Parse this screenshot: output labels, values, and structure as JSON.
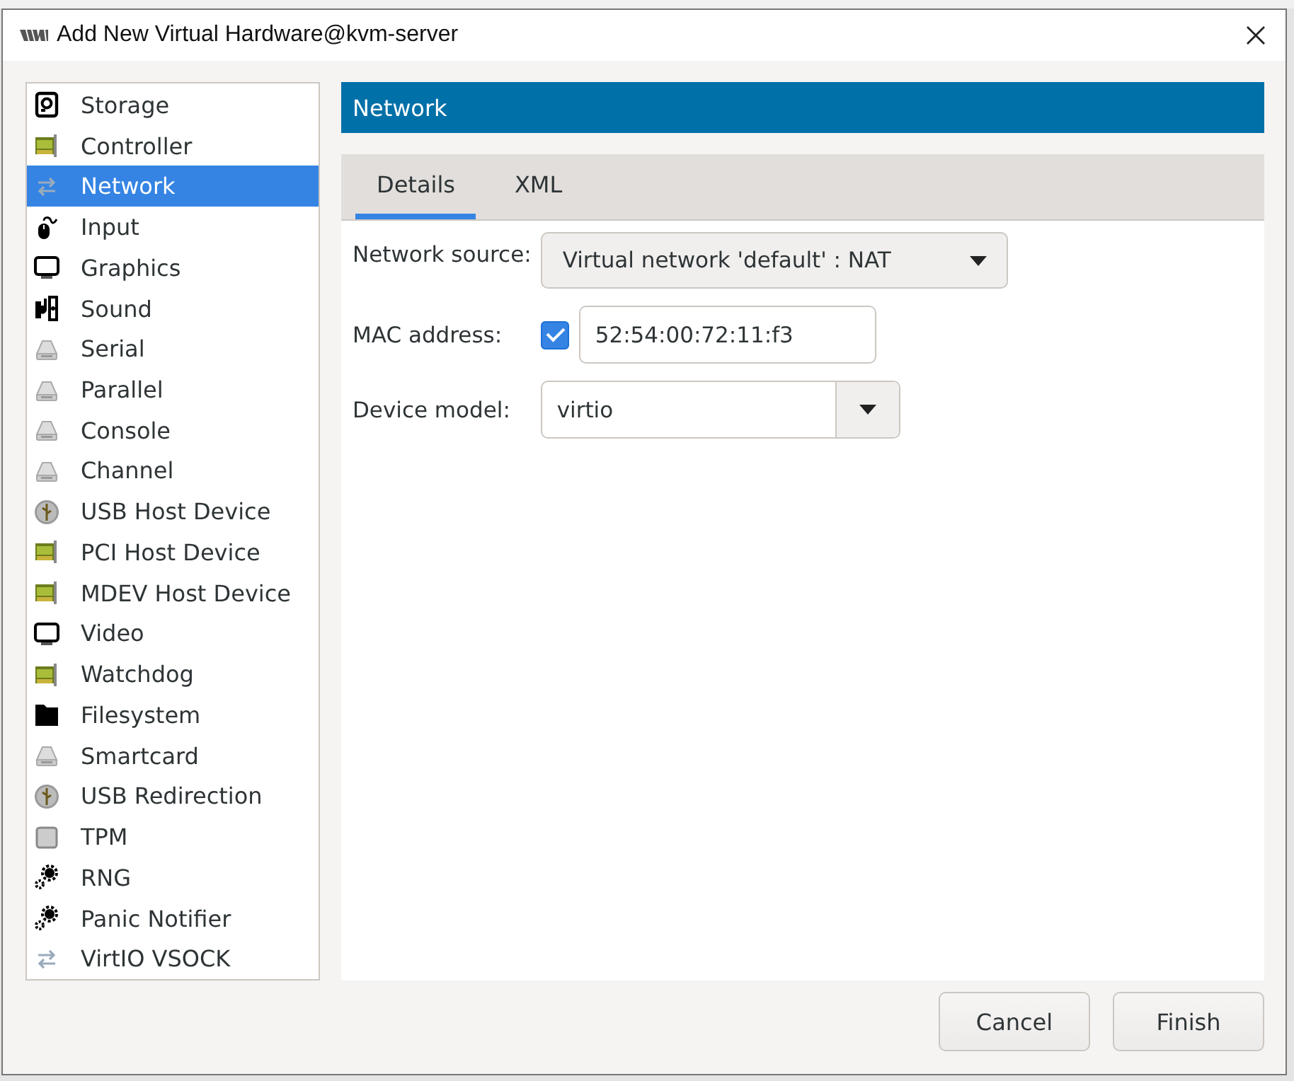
{
  "window": {
    "title": "Add New Virtual Hardware@kvm-server"
  },
  "sidebar": {
    "items": [
      {
        "label": "Storage",
        "kind": "disk",
        "selected": false
      },
      {
        "label": "Controller",
        "kind": "card",
        "selected": false
      },
      {
        "label": "Network",
        "kind": "arrows",
        "selected": true
      },
      {
        "label": "Input",
        "kind": "mouse",
        "selected": false
      },
      {
        "label": "Graphics",
        "kind": "monitor",
        "selected": false
      },
      {
        "label": "Sound",
        "kind": "sound",
        "selected": false
      },
      {
        "label": "Serial",
        "kind": "port",
        "selected": false
      },
      {
        "label": "Parallel",
        "kind": "port",
        "selected": false
      },
      {
        "label": "Console",
        "kind": "port",
        "selected": false
      },
      {
        "label": "Channel",
        "kind": "port",
        "selected": false
      },
      {
        "label": "USB Host Device",
        "kind": "usb",
        "selected": false
      },
      {
        "label": "PCI Host Device",
        "kind": "card",
        "selected": false
      },
      {
        "label": "MDEV Host Device",
        "kind": "card",
        "selected": false
      },
      {
        "label": "Video",
        "kind": "monitor",
        "selected": false
      },
      {
        "label": "Watchdog",
        "kind": "card",
        "selected": false
      },
      {
        "label": "Filesystem",
        "kind": "folder",
        "selected": false
      },
      {
        "label": "Smartcard",
        "kind": "port",
        "selected": false
      },
      {
        "label": "USB Redirection",
        "kind": "usb",
        "selected": false
      },
      {
        "label": "TPM",
        "kind": "chip",
        "selected": false
      },
      {
        "label": "RNG",
        "kind": "gears",
        "selected": false
      },
      {
        "label": "Panic Notifier",
        "kind": "gears",
        "selected": false
      },
      {
        "label": "VirtIO VSOCK",
        "kind": "arrows",
        "selected": false
      }
    ]
  },
  "panel": {
    "title": "Network",
    "tabs": [
      {
        "label": "Details",
        "selected": true
      },
      {
        "label": "XML",
        "selected": false
      }
    ],
    "fields": [
      {
        "kind": "combo",
        "label": "Network source:",
        "value": "Virtual network 'default' : NAT"
      },
      {
        "kind": "mac",
        "label": "MAC address:",
        "checked": true,
        "value": "52:54:00:72:11:f3"
      },
      {
        "kind": "entry-combo",
        "label": "Device model:",
        "value": "virtio"
      }
    ]
  },
  "buttons": [
    "Cancel",
    "Finish"
  ]
}
